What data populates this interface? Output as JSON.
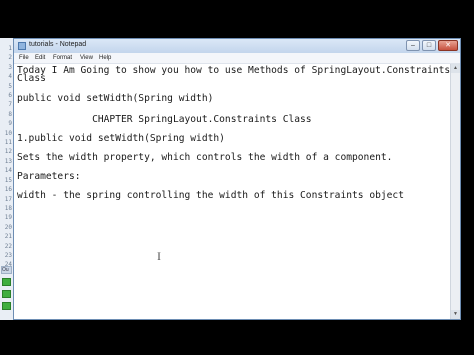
{
  "window": {
    "title": "tutorials - Notepad",
    "minimize_glyph": "–",
    "maximize_glyph": "□",
    "close_glyph": "✕"
  },
  "menu": {
    "items": [
      "File",
      "Edit",
      "Format",
      "View",
      "Help"
    ]
  },
  "document": {
    "lines": [
      "Today I Am Going to show you how to use Methods of SpringLayout.Constraints",
      "Class",
      "public void setWidth(Spring width)",
      "             CHAPTER SpringLayout.Constraints Class",
      "1.public void setWidth(Spring width)",
      "Sets the width property, which controls the width of a component.",
      "Parameters:",
      "width - the spring controlling the width of this Constraints object"
    ],
    "caret_glyph": "I"
  },
  "ide": {
    "line_numbers": [
      "1",
      "2",
      "3",
      "4",
      "5",
      "6",
      "7",
      "8",
      "9",
      "10",
      "11",
      "12",
      "13",
      "14",
      "15",
      "16",
      "17",
      "18",
      "19",
      "20",
      "21",
      "22",
      "23",
      "24"
    ],
    "tab_label": "Ou"
  },
  "colors": {
    "window_border": "#6d8db3",
    "title_bar": "#c3d5ec",
    "close_button": "#c7523f",
    "ide_green": "#3fae3f"
  }
}
